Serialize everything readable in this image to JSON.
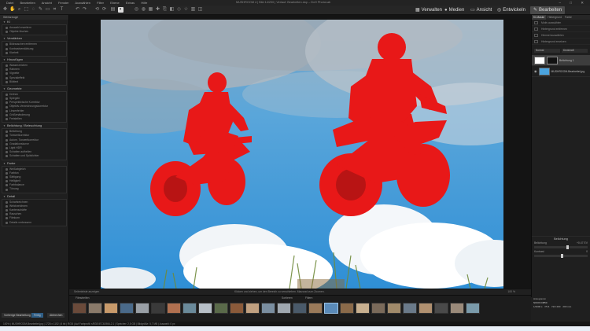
{
  "app": {
    "title": "MUSHROOM 4 | Bild 14/200 | Verlauf: Bearbeiten.dop – DxO PhotoLab",
    "menu": [
      "Datei",
      "Bearbeiten",
      "Ansicht",
      "Fenster",
      "Auswählen",
      "Filter",
      "Ebene",
      "Extras",
      "Hilfe"
    ],
    "window_controls": [
      "–",
      "□",
      "✕"
    ]
  },
  "toolbar": {
    "modes": [
      {
        "label": "Verwalten",
        "icon": "grid-icon"
      },
      {
        "label": "Medien",
        "icon": "circle-icon"
      },
      {
        "label": "Ansicht",
        "icon": "monitor-icon"
      },
      {
        "label": "Entwickeln",
        "icon": "aperture-icon"
      },
      {
        "label": "Bearbeiten",
        "icon": "pencil-icon"
      }
    ]
  },
  "left_panel": {
    "tab": "Werkzeuge",
    "sections": [
      {
        "title": "KI",
        "items": [
          "Auswahl erweitern",
          "Objekte löschen"
        ]
      },
      {
        "title": "Verstärken",
        "items": [
          "Bildrauschen entfernen",
          "Kontrastverstärkung",
          "Klarheit"
        ]
      },
      {
        "title": "Hinzufügen",
        "items": [
          "Wasserzeichen",
          "Rahmen",
          "Vignette",
          "Spezialeffekt",
          "Bildtext"
        ]
      },
      {
        "title": "Geometrie",
        "items": [
          "Drehen",
          "Spiegeln",
          "Perspektivische Korrektur",
          "Objektiv-Verzeichnungskorrektur",
          "Linsenfehler",
          "Größenänderung",
          "Freistellen"
        ]
      },
      {
        "title": "Belichtung / Beleuchtung",
        "items": [
          "Belichtung",
          "Tonwertkorrektur",
          "Autom. Tonwertkorrektur",
          "Gradationskurve",
          "Light HDR",
          "Schatten aufhellen",
          "Schatten und Spitzlichter"
        ]
      },
      {
        "title": "Farbe",
        "items": [
          "Weißabgleich",
          "Farbton",
          "Sättigung",
          "Helligkeit",
          "Farbbalance",
          "Tönung"
        ]
      },
      {
        "title": "Detail",
        "items": [
          "Scharfzeichnen",
          "Weichzeichnen",
          "Kantenschärfe",
          "Rauschen",
          "Filmkorn",
          "Details verbessern"
        ]
      }
    ]
  },
  "viewer": {
    "left_label": "Seitenleiste anzeigen",
    "center_label": "Klicken und ziehen, um den Bereich zu verschieben. Mausrad zum Zoomen.",
    "right_label": "100 %"
  },
  "right_panel": {
    "tabs": [
      "KI-Maske",
      "Hintergrund",
      "Farbe"
    ],
    "tools": [
      "Motiv auswählen",
      "Hintergrund entfernen",
      "Himmel auswählen",
      "Hintergrund ersetzen"
    ],
    "blend_label": "Normal",
    "opacity_label": "Deckkraft",
    "layers": [
      {
        "name": "Belichtung 1",
        "selected": true
      },
      {
        "name": "MUSHROOM-Bearbeitet.jpg",
        "selected": false
      }
    ],
    "adjust_title": "Belichtung",
    "sliders": [
      {
        "label": "Belichtung",
        "value": "+0.47 EV",
        "pos": 0.6
      },
      {
        "label": "Kontrast",
        "value": "0",
        "pos": 0.5
      }
    ],
    "info": {
      "title": "Histogramm",
      "file": "NIKON D850",
      "params": [
        "1/2000 s",
        "f/5.6",
        "ISO 400",
        "200 mm"
      ]
    }
  },
  "filmstrip": {
    "tabs": [
      "Filmstreifen",
      "Sortieren",
      "Filtern"
    ],
    "left_buttons": [
      "Vorherige Bearbeitung",
      "Fertig",
      "Abbrechen"
    ],
    "thumb_count": 26,
    "selected_index": 16
  },
  "statusbar": {
    "text": "100%  |  MUSHROOM-Bearbeitet.jpg  |  1728 x 1152  |  8 bit  |  RGB  |  Auf Farbprofil: sRGB IEC61966-2.1  |  Speicher: 2,5 GB  |  Bildgröße: 5,7 MB  |  Auswahl: 0 px"
  },
  "colors": {
    "accent": "#9bc3e6",
    "mask_red": "#e81818",
    "sky": "#4aa3de"
  }
}
